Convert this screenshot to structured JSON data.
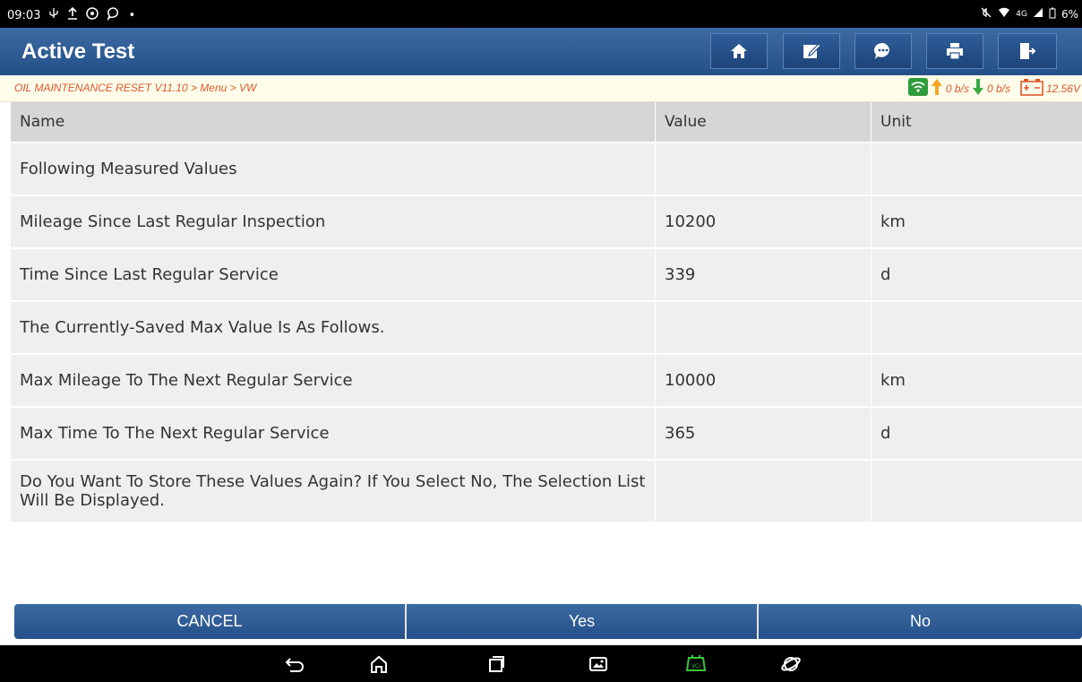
{
  "status_bar": {
    "time": "09:03",
    "network": "4G",
    "battery": "6%"
  },
  "header": {
    "title": "Active Test",
    "buttons": [
      {
        "icon": "home-icon"
      },
      {
        "icon": "edit-icon"
      },
      {
        "icon": "chat-icon"
      },
      {
        "icon": "print-icon"
      },
      {
        "icon": "exit-icon"
      }
    ]
  },
  "breadcrumb": {
    "path": "OIL MAINTENANCE RESET V11.10 > Menu > VW",
    "upload": "0 b/s",
    "download": "0 b/s",
    "voltage": "12.56V"
  },
  "table": {
    "columns": [
      "Name",
      "Value",
      "Unit"
    ],
    "rows": [
      {
        "name": "Following Measured Values",
        "value": "",
        "unit": ""
      },
      {
        "name": "Mileage Since Last Regular Inspection",
        "value": "10200",
        "unit": "km"
      },
      {
        "name": "Time Since Last Regular Service",
        "value": "339",
        "unit": "d"
      },
      {
        "name": "The Currently-Saved Max Value Is As Follows.",
        "value": "",
        "unit": ""
      },
      {
        "name": "Max Mileage To The Next Regular Service",
        "value": "10000",
        "unit": "km"
      },
      {
        "name": "Max Time To The Next Regular Service",
        "value": "365",
        "unit": "d"
      },
      {
        "name": "Do You Want To Store These Values Again? If You Select No, The Selection List Will Be Displayed.",
        "value": "",
        "unit": ""
      }
    ]
  },
  "actions": {
    "cancel": "CANCEL",
    "yes": "Yes",
    "no": "No"
  },
  "colors": {
    "accent": "#2b5a94",
    "breadcrumb_text": "#e0582d",
    "wifi_green": "#2e9c3a",
    "upload_arrow": "#f5a623",
    "download_arrow": "#3aa845",
    "vci_green": "#3cc43c"
  }
}
